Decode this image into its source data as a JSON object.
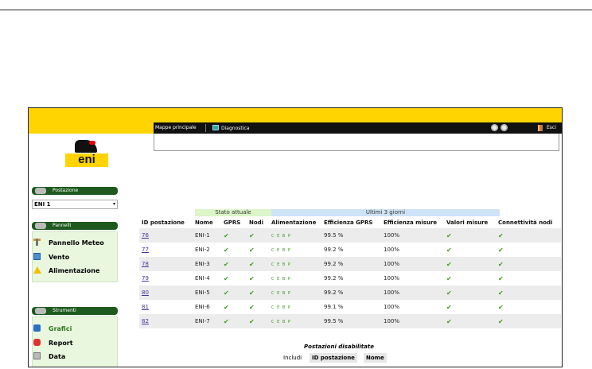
{
  "topbar": {
    "mappe_label": "Mappe principale",
    "diagnostica_label": "Diagnostica",
    "esci_label": "Esci"
  },
  "logo": {
    "text": "eni"
  },
  "sidebar": {
    "postazione": {
      "title": "Postazione",
      "selected": "ENI 1"
    },
    "pannelli": {
      "title": "Pannelli",
      "items": [
        {
          "label": "Pannello Meteo",
          "icon": "thermometer-icon"
        },
        {
          "label": "Vento",
          "icon": "wind-icon"
        },
        {
          "label": "Alimentazione",
          "icon": "warning-icon"
        }
      ]
    },
    "strumenti": {
      "title": "Strumenti",
      "items": [
        {
          "label": "Grafici",
          "icon": "chart-icon",
          "active": true
        },
        {
          "label": "Report",
          "icon": "report-icon"
        },
        {
          "label": "Data",
          "icon": "calendar-icon"
        }
      ]
    }
  },
  "table": {
    "group_headers": {
      "stato_attuale": "Stato attuale",
      "ultimi": "Ultimi 3 giorni"
    },
    "columns": [
      "ID postazione",
      "Nome",
      "GPRS",
      "Nodi",
      "Alimentazione",
      "Efficienza GPRS",
      "Efficienza misure",
      "Valori misure",
      "Connettività nodi"
    ],
    "alimentazione_codes": "C E B P",
    "rows": [
      {
        "id": "76",
        "nome": "ENI-1",
        "eff_gprs": "99.5 %",
        "eff_misure": "100%"
      },
      {
        "id": "77",
        "nome": "ENI-2",
        "eff_gprs": "99.2 %",
        "eff_misure": "100%"
      },
      {
        "id": "78",
        "nome": "ENI-3",
        "eff_gprs": "99.2 %",
        "eff_misure": "100%"
      },
      {
        "id": "79",
        "nome": "ENI-4",
        "eff_gprs": "99.2 %",
        "eff_misure": "100%"
      },
      {
        "id": "80",
        "nome": "ENI-5",
        "eff_gprs": "99.2 %",
        "eff_misure": "100%"
      },
      {
        "id": "81",
        "nome": "ENI-6",
        "eff_gprs": "99.1 %",
        "eff_misure": "100%"
      },
      {
        "id": "82",
        "nome": "ENI-7",
        "eff_gprs": "99.5 %",
        "eff_misure": "100%"
      }
    ]
  },
  "disabled": {
    "title": "Postazioni disabilitate",
    "includi": "Includi",
    "col_id": "ID postazione",
    "col_nome": "Nome"
  }
}
